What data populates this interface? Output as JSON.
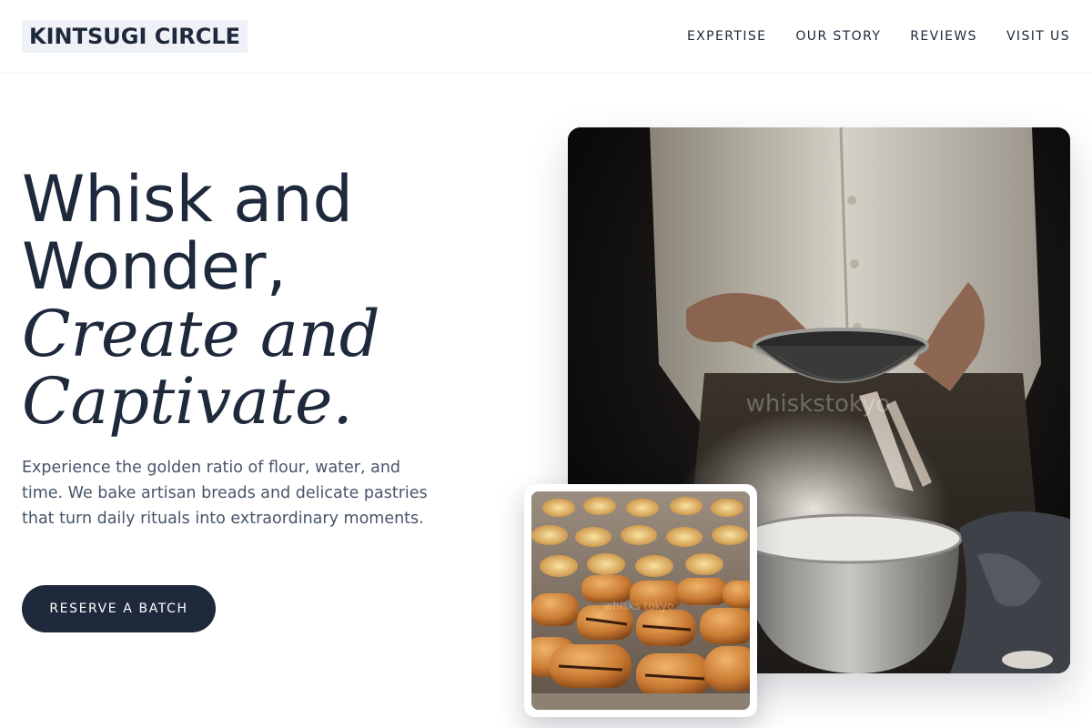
{
  "brand": {
    "name": "KINTSUGI CIRCLE"
  },
  "nav": {
    "items": [
      {
        "label": "EXPERTISE"
      },
      {
        "label": "OUR STORY"
      },
      {
        "label": "REVIEWS"
      },
      {
        "label": "VISIT US"
      }
    ]
  },
  "hero": {
    "headline_line1": "Whisk and",
    "headline_line2": "Wonder,",
    "headline_italic_line1": "Create and",
    "headline_italic_line2": "Captivate.",
    "description": "Experience the golden ratio of flour, water, and time. We bake artisan breads and delicate pastries that turn daily rituals into extraordinary moments.",
    "cta_label": "RESERVE A BATCH"
  },
  "images": {
    "main": {
      "subject": "baker sifting flour into bowl",
      "watermark": "whiskstokyo"
    },
    "secondary": {
      "subject": "tray of chocolate croissants",
      "watermark": "whisks tokyo"
    }
  },
  "colors": {
    "primary": "#1e293b",
    "text_muted": "#475569",
    "logo_bg": "#eef1f6",
    "background": "#ffffff"
  }
}
